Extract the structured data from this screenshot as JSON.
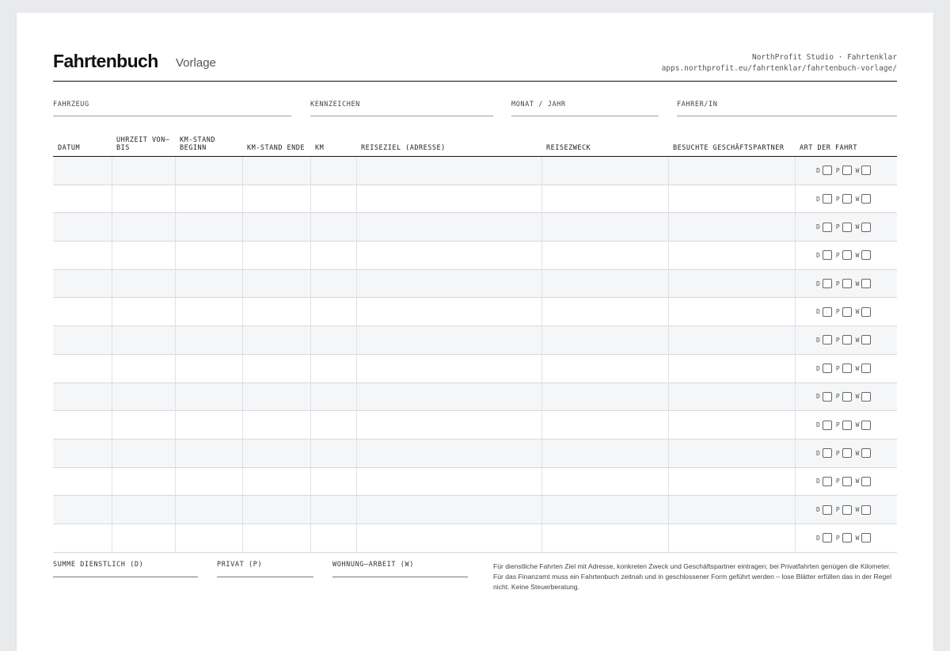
{
  "header": {
    "title": "Fahrtenbuch",
    "subtitle": "Vorlage",
    "brand_line": "NorthProfit Studio · Fahrtenklar",
    "url_line": "apps.northprofit.eu/fahrtenklar/fahrtenbuch-vorlage/"
  },
  "fields": {
    "fahrzeug": "FAHRZEUG",
    "kennzeichen": "KENNZEICHEN",
    "monat": "MONAT / JAHR",
    "fahrer": "FAHRER/IN"
  },
  "table": {
    "columns": {
      "datum": "DATUM",
      "uhrzeit": "UHRZEIT VON–BIS",
      "km_beginn": "KM-STAND BEGINN",
      "km_ende": "KM-STAND ENDE",
      "km": "KM",
      "reiseziel": "REISEZIEL (ADRESSE)",
      "reisezweck": "REISEZWECK",
      "partner": "BESUCHTE GESCHÄFTSPARTNER",
      "art": "ART DER FAHRT"
    },
    "row_count": 14,
    "art_options": [
      "D",
      "P",
      "W"
    ]
  },
  "summary": {
    "dienstlich": "SUMME DIENSTLICH (D)",
    "privat": "PRIVAT (P)",
    "wohnung": "WOHNUNG–ARBEIT (W)"
  },
  "note": "Für dienstliche Fahrten Ziel mit Adresse, konkreten Zweck und Geschäftspartner eintragen; bei Privatfahrten genügen die Kilometer. Für das Finanzamt muss ein Fahrtenbuch zeitnah und in geschlossener Form geführt werden – lose Blätter erfüllen das in der Regel nicht. Keine Steuerberatung."
}
